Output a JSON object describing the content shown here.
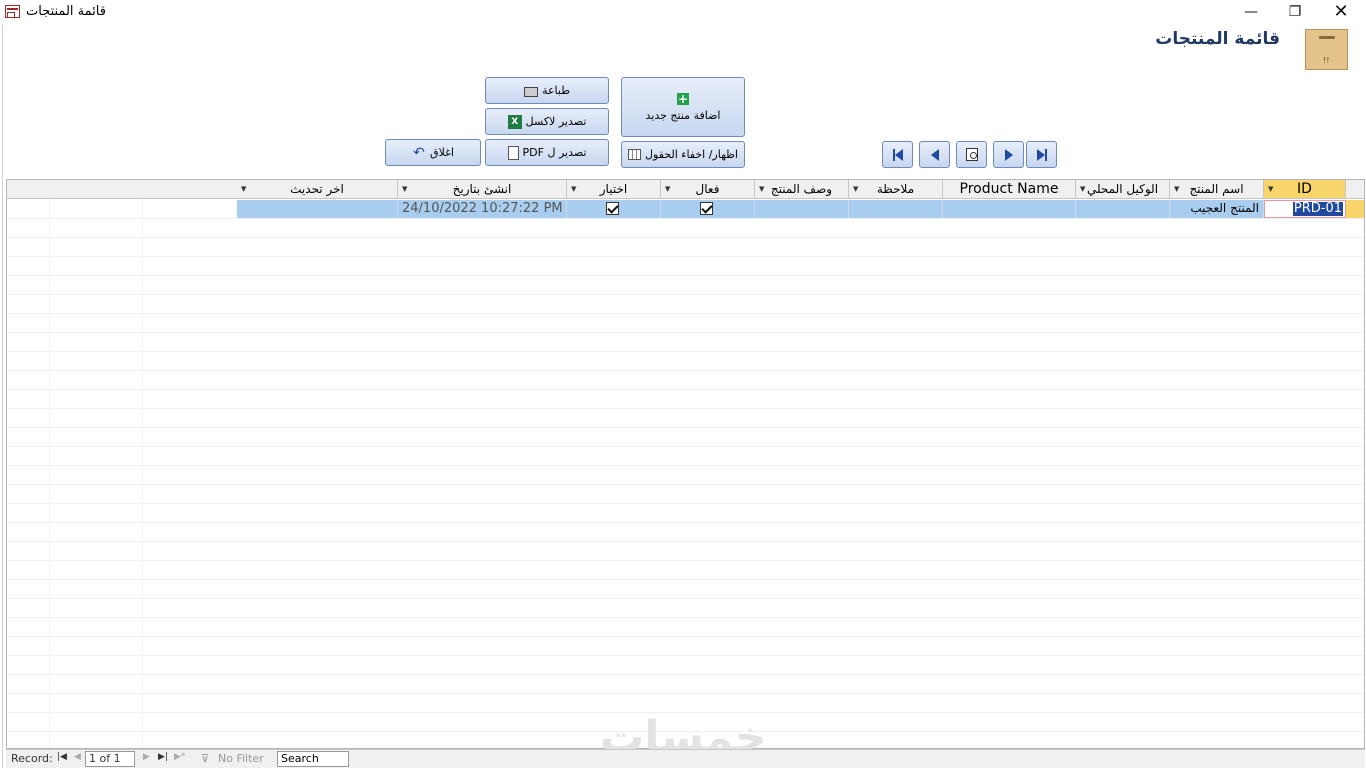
{
  "window": {
    "title": "قائمة المنتجات",
    "minimize": "—",
    "maximize": "❐",
    "close": "✕"
  },
  "header": {
    "title": "قائمة المنتجات"
  },
  "toolbar": {
    "print_label": "طباعة",
    "export_excel_label": "تصدير لاكسل",
    "export_pdf_label": "تصدير ل PDF",
    "close_label": "اغلاق",
    "add_product_label": "اضافة منتج جديد",
    "toggle_fields_label": "اظهار/ اخفاء الحقول",
    "plus_glyph": "+",
    "excel_glyph": "X",
    "back_glyph": "↶"
  },
  "table": {
    "columns": [
      "ID",
      "اسم المنتج",
      "الوكيل المحلي",
      "Product Name",
      "ملاحظة",
      "وصف المنتج",
      "فعال",
      "اختيار",
      "انشئ بتاريخ",
      "اخر تحديث"
    ],
    "rows": [
      {
        "id": "PRD-01",
        "name": "المنتج العجيب",
        "agent": "",
        "product_name": "",
        "note": "",
        "description": "",
        "active": true,
        "selected": true,
        "created": "24/10/2022 10:27:22 PM",
        "updated": ""
      }
    ]
  },
  "statusbar": {
    "record_label": "Record:",
    "record_value": "1 of 1",
    "filter_label": "No Filter",
    "search_label": "Search"
  },
  "watermark": "خمسات",
  "colors": {
    "selected_row": "#a9cdef",
    "active_header": "#f7d56a",
    "button_border": "#6f8bb8",
    "accent_nav": "#1f4aa0"
  }
}
